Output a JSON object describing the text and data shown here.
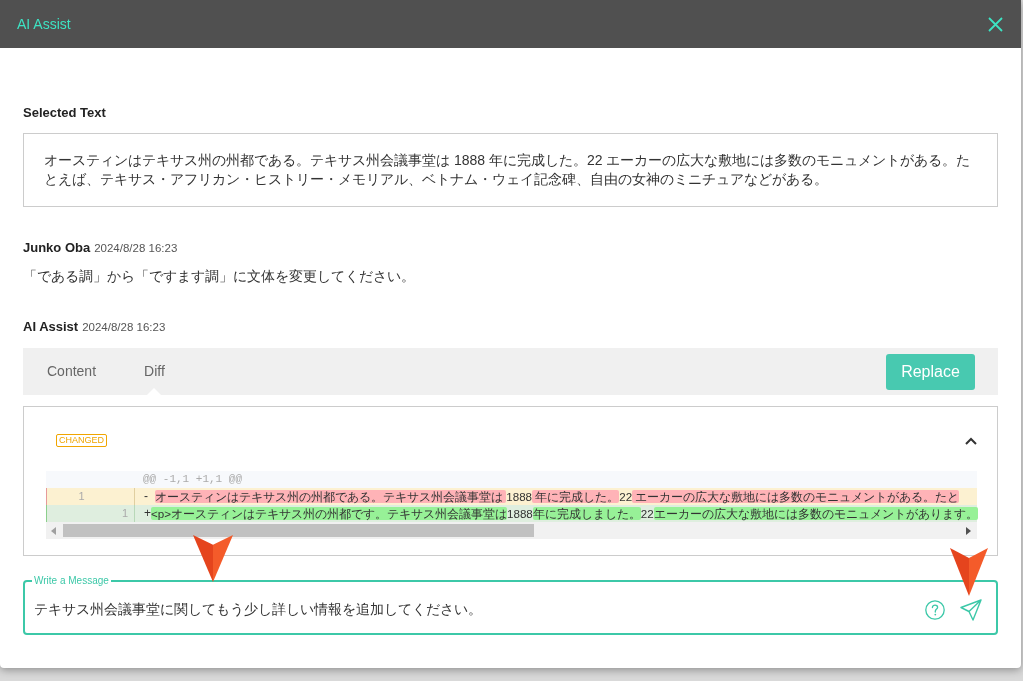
{
  "window": {
    "title": "AI Assist"
  },
  "selected_text": {
    "label": "Selected Text",
    "text": "オースティンはテキサス州の州都である。テキサス州会議事堂は 1888 年に完成した。22 エーカーの広大な敷地には多数のモニュメントがある。たとえば、テキサス・アフリカン・ヒストリー・メモリアル、ベトナム・ウェイ記念碑、自由の女神のミニチュアなどがある。"
  },
  "messages": [
    {
      "kind": "user",
      "author": "Junko Oba",
      "time": "2024/8/28 16:23",
      "text": "「である調」から「ですます調」に文体を変更してください。"
    },
    {
      "kind": "assistant",
      "author": "AI Assist",
      "time": "2024/8/28 16:23",
      "tabs": [
        {
          "label": "Content",
          "selected": false
        },
        {
          "label": "Diff",
          "selected": true
        }
      ],
      "replace_button": "Replace",
      "diff": {
        "status": "CHANGED",
        "expanded": true,
        "hunk_header": "@@ -1,1 +1,1 @@",
        "lines": [
          {
            "kind": "deleted",
            "old_number": "1",
            "sign": "-",
            "segments": [
              {
                "text": "オースティンはテキサス州の州都である。テキサス州会議事堂は ",
                "changed": true
              },
              {
                "text": "1888",
                "changed": false
              },
              {
                "text": " 年に完成した。",
                "changed": true
              },
              {
                "text": "22",
                "changed": false
              },
              {
                "text": " エーカーの広大な敷地には多数のモニュメントがある。たと",
                "changed": true
              }
            ]
          },
          {
            "kind": "added",
            "new_number": "1",
            "sign": "+",
            "segments": [
              {
                "text": "<p>オースティンはテキサス州の州都です。テキサス州会議事堂は",
                "changed": true
              },
              {
                "text": "1888",
                "changed": false
              },
              {
                "text": "年に完成しました。",
                "changed": true
              },
              {
                "text": "22",
                "changed": false
              },
              {
                "text": "エーカーの広大な敷地には多数のモニュメントがあります。",
                "changed": true
              }
            ]
          }
        ]
      }
    }
  ],
  "composer": {
    "label": "Write a Message",
    "value": "テキサス州会議事堂に関してもう少し詳しい情報を追加してください。"
  }
}
